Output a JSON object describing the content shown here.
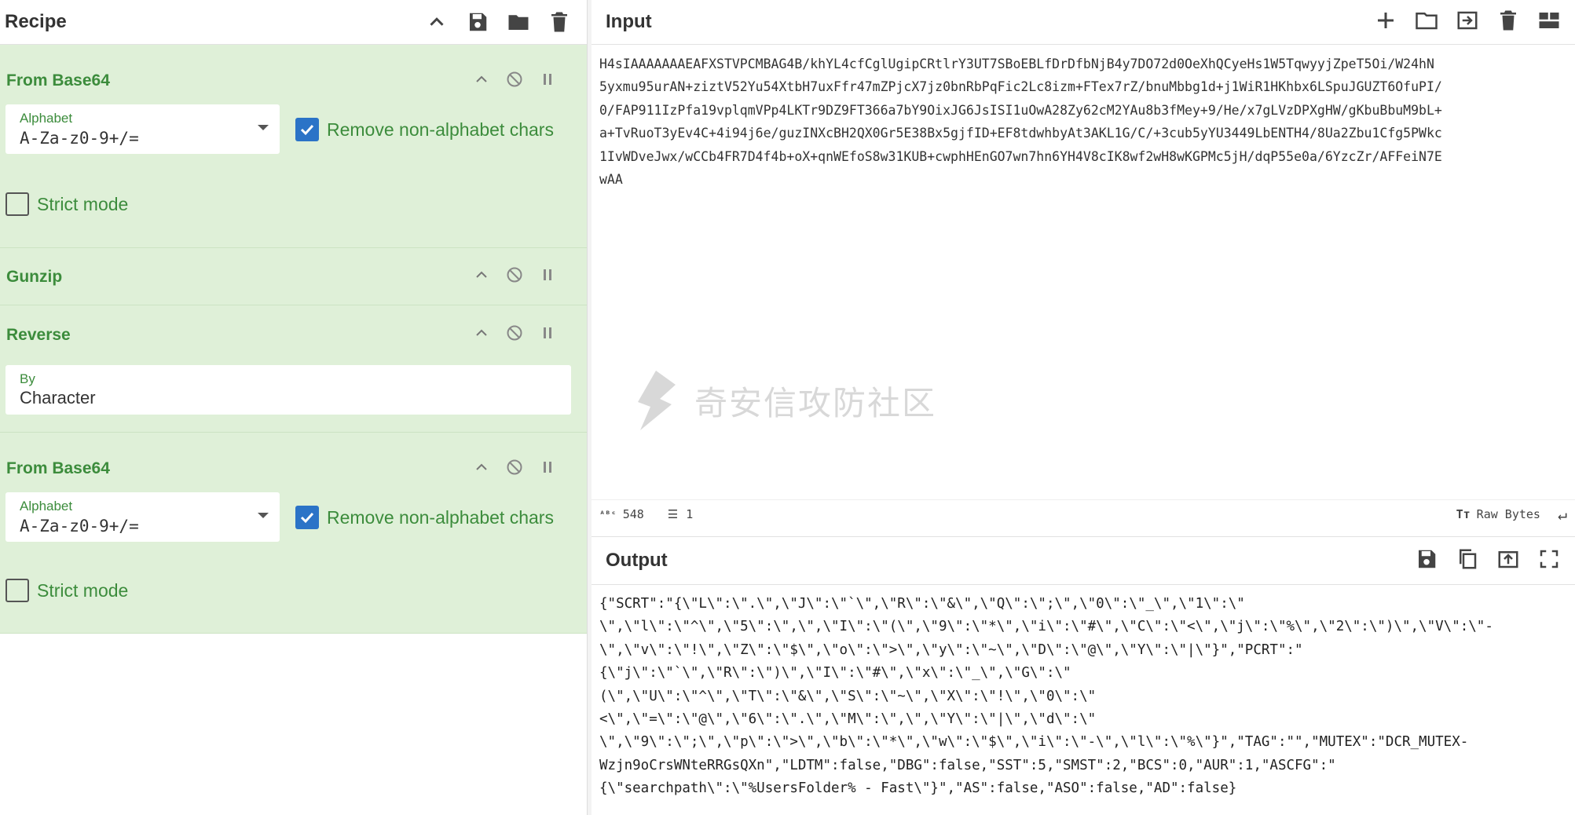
{
  "recipe": {
    "title": "Recipe",
    "operations": [
      {
        "name": "From Base64",
        "alphabet_label": "Alphabet",
        "alphabet_value": "A-Za-z0-9+/=",
        "remove_label": "Remove non-alphabet chars",
        "strict_label": "Strict mode"
      },
      {
        "name": "Gunzip"
      },
      {
        "name": "Reverse",
        "by_label": "By",
        "by_value": "Character"
      },
      {
        "name": "From Base64",
        "alphabet_label": "Alphabet",
        "alphabet_value": "A-Za-z0-9+/=",
        "remove_label": "Remove non-alphabet chars",
        "strict_label": "Strict mode"
      }
    ]
  },
  "input": {
    "title": "Input",
    "text": "H4sIAAAAAAAEAFXSTVPCMBAG4B/khYL4cfCglUgipCRtlrY3UT7SBoEBLfDrDfbNjB4y7DO72d0OeXhQCyeHs1W5TqwyyjZpeT5Oi/W24hN\n5yxmu95urAN+ziztV52Yu54XtbH7uxFfr47mZPjcX7jz0bnRbPqFic2Lc8izm+FTex7rZ/bnuMbbg1d+j1WiR1HKhbx6LSpuJGUZT6OfuPI/\n0/FAP911IzPfa19vplqmVPp4LKTr9DZ9FT366a7bY9OixJG6JsISI1uOwA28Zy62cM2YAu8b3fMey+9/He/x7gLVzDPXgHW/gKbuBbuM9bL+\na+TvRuoT3yEv4C+4i94j6e/guzINXcBH2QX0Gr5E38Bx5gjfID+EF8tdwhbyAt3AKL1G/C/+3cub5yYU3449LbENTH4/8Ua2Zbu1Cfg5PWkc\n1IvWDveJwx/wCCb4FR7D4f4b+oX+qnWEfoS8w31KUB+cwphHEnGO7wn7hn6YH4V8cIK8wf2wH8wKGPMc5jH/dqP55e0a/6YzcZr/AFFeiN7E\nwAA",
    "char_count": "548",
    "line_count": "1",
    "raw_bytes_label": "Raw Bytes"
  },
  "output": {
    "title": "Output",
    "text": "{\"SCRT\":\"{\\\"L\\\":\\\".\\\",\\\"J\\\":\\\"`\\\",\\\"R\\\":\\\"&\\\",\\\"Q\\\":\\\";\\\",\\\"0\\\":\\\"_\\\",\\\"1\\\":\\\"\n\\\",\\\"l\\\":\\\"^\\\",\\\"5\\\":\\\",\\\",\\\"I\\\":\\\"(\\\",\\\"9\\\":\\\"*\\\",\\\"i\\\":\\\"#\\\",\\\"C\\\":\\\"<\\\",\\\"j\\\":\\\"%\\\",\\\"2\\\":\\\")\\\",\\\"V\\\":\\\"-\n\\\",\\\"v\\\":\\\"!\\\",\\\"Z\\\":\\\"$\\\",\\\"o\\\":\\\">\\\",\\\"y\\\":\\\"~\\\",\\\"D\\\":\\\"@\\\",\\\"Y\\\":\\\"|\\\"}\",\"PCRT\":\"\n{\\\"j\\\":\\\"`\\\",\\\"R\\\":\\\")\\\",\\\"I\\\":\\\"#\\\",\\\"x\\\":\\\"_\\\",\\\"G\\\":\\\"\n(\\\",\\\"U\\\":\\\"^\\\",\\\"T\\\":\\\"&\\\",\\\"S\\\":\\\"~\\\",\\\"X\\\":\\\"!\\\",\\\"0\\\":\\\"\n<\\\",\\\"=\\\":\\\"@\\\",\\\"6\\\":\\\".\\\",\\\"M\\\":\\\",\\\",\\\"Y\\\":\\\"|\\\",\\\"d\\\":\\\"\n\\\",\\\"9\\\":\\\";\\\",\\\"p\\\":\\\">\\\",\\\"b\\\":\\\"*\\\",\\\"w\\\":\\\"$\\\",\\\"i\\\":\\\"-\\\",\\\"l\\\":\\\"%\\\"}\",\"TAG\":\"\",\"MUTEX\":\"DCR_MUTEX-\nWzjn9oCrsWNteRRGsQXn\",\"LDTM\":false,\"DBG\":false,\"SST\":5,\"SMST\":2,\"BCS\":0,\"AUR\":1,\"ASCFG\":\"\n{\\\"searchpath\\\":\\\"%UsersFolder% - Fast\\\"}\",\"AS\":false,\"ASO\":false,\"AD\":false}"
  },
  "watermark": {
    "text": "奇安信攻防社区"
  },
  "colors": {
    "op_bg": "#dff0d8",
    "op_green": "#3c8c3c",
    "check_blue": "#2b73c7"
  }
}
